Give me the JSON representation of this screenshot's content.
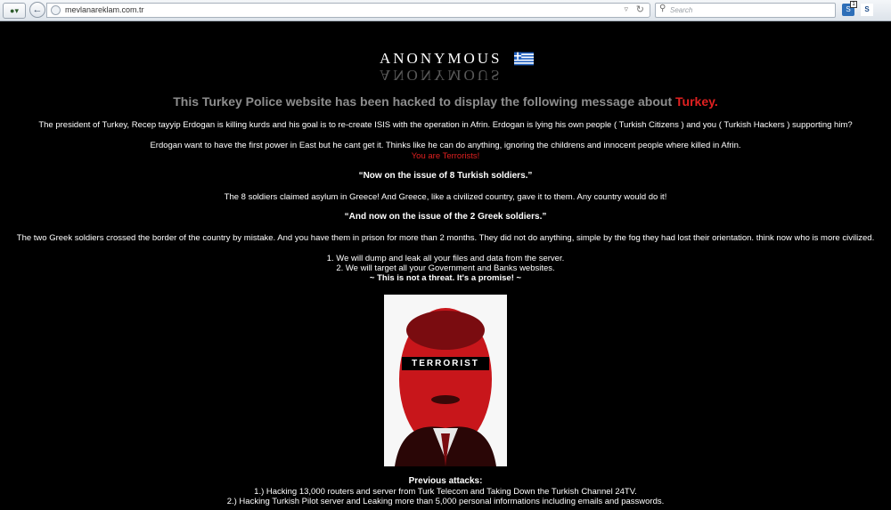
{
  "browser": {
    "url": "mevlanareklam.com.tr",
    "search_placeholder": "Search",
    "ext_badge": "1",
    "ext2_label": "S"
  },
  "page": {
    "logo_text": "ANONYMOUS",
    "headline_main": "This Turkey Police website has been hacked to display the following message about ",
    "headline_accent": "Turkey.",
    "para1": "The president of Turkey, Recep tayyip Erdogan is killing kurds and his goal is to re-create ISIS with the operation in Afrin. Erdogan is lying his own people ( Turkish Citizens ) and you ( Turkish Hackers ) supporting him?",
    "para2": "Erdogan want to have the first power in East but he cant get it. Thinks like he can do anything, ignoring the childrens and innocent people where killed in Afrin.",
    "para2_red": "You are Terrorists!",
    "heading1": "“Now on the issue of 8 Turkish soldiers.”",
    "para3": "The 8 soldiers claimed asylum in Greece! And Greece, like a civilized country, gave it to them. Any country would do it!",
    "heading2": "“And now on the issue of the 2 Greek soldiers.”",
    "para4": "The two Greek soldiers crossed the border of the country by mistake. And you have them in prison for more than 2 months. They did not do anything, simple by the fog they had lost their orientation. think now who is more civilized.",
    "threat1": "1. We will dump and leak all your files and data from the server.",
    "threat2": "2. We will target all your Government and Banks websites.",
    "promise": "~ This is not a threat. It's a promise! ~",
    "portrait_label": "TERRORIST",
    "prev_title": "Previous attacks:",
    "prev1": "1.) Hacking 13,000 routers and server from Turk Telecom and Taking Down the Turkish Channel 24TV.",
    "prev2": "2.) Hacking Turkish Pilot server and Leaking more than 5,000 personal informations including emails and passwords."
  },
  "colors": {
    "accent_red": "#e02020",
    "headline_gray": "#8d8d8d",
    "background": "#000000"
  },
  "icons": [
    "menu-icon",
    "back-arrow-icon",
    "globe-icon",
    "dropdown-arrow-icon",
    "reload-icon",
    "search-icon",
    "extension-icon",
    "greek-flag-icon"
  ]
}
